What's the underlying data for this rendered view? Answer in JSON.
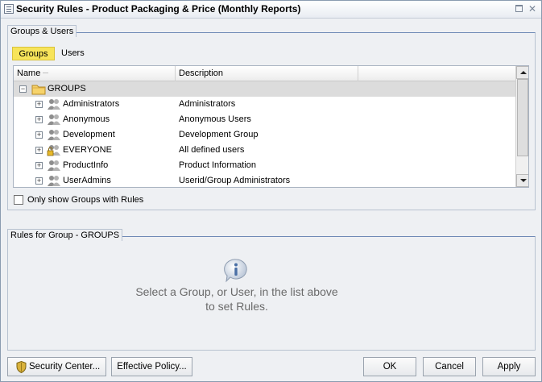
{
  "window": {
    "title": "Security Rules - Product Packaging & Price (Monthly Reports)",
    "restore_glyph": "",
    "close_glyph": "✕"
  },
  "groups_users": {
    "legend": "Groups & Users",
    "tabs": [
      {
        "label": "Groups",
        "selected": true
      },
      {
        "label": "Users",
        "selected": false
      }
    ],
    "columns": [
      "Name",
      "Description",
      ""
    ],
    "root": {
      "expander": "−",
      "name": "GROUPS",
      "icon": "folder-icon"
    },
    "rows": [
      {
        "name": "Administrators",
        "description": "Administrators",
        "icon": "group-icon"
      },
      {
        "name": "Anonymous",
        "description": "Anonymous Users",
        "icon": "group-icon"
      },
      {
        "name": "Development",
        "description": "Development Group",
        "icon": "group-icon"
      },
      {
        "name": "EVERYONE",
        "description": "All defined users",
        "icon": "group-lock-icon"
      },
      {
        "name": "ProductInfo",
        "description": "Product Information",
        "icon": "group-icon"
      },
      {
        "name": "UserAdmins",
        "description": "Userid/Group Administrators",
        "icon": "group-icon"
      }
    ],
    "row_expander": "+",
    "only_rules_checkbox": {
      "label": "Only show Groups with Rules",
      "checked": false
    }
  },
  "rules": {
    "legend": "Rules for Group - GROUPS",
    "message_line1": "Select a Group, or User, in the list above",
    "message_line2": "to set Rules."
  },
  "buttons": {
    "security_center": "Security Center...",
    "effective_policy": "Effective Policy...",
    "ok": "OK",
    "cancel": "Cancel",
    "apply": "Apply"
  },
  "colors": {
    "selected_tab": "#f7e45a",
    "root_row": "#dcdcdc",
    "section_rule": "#6f8ab6"
  }
}
